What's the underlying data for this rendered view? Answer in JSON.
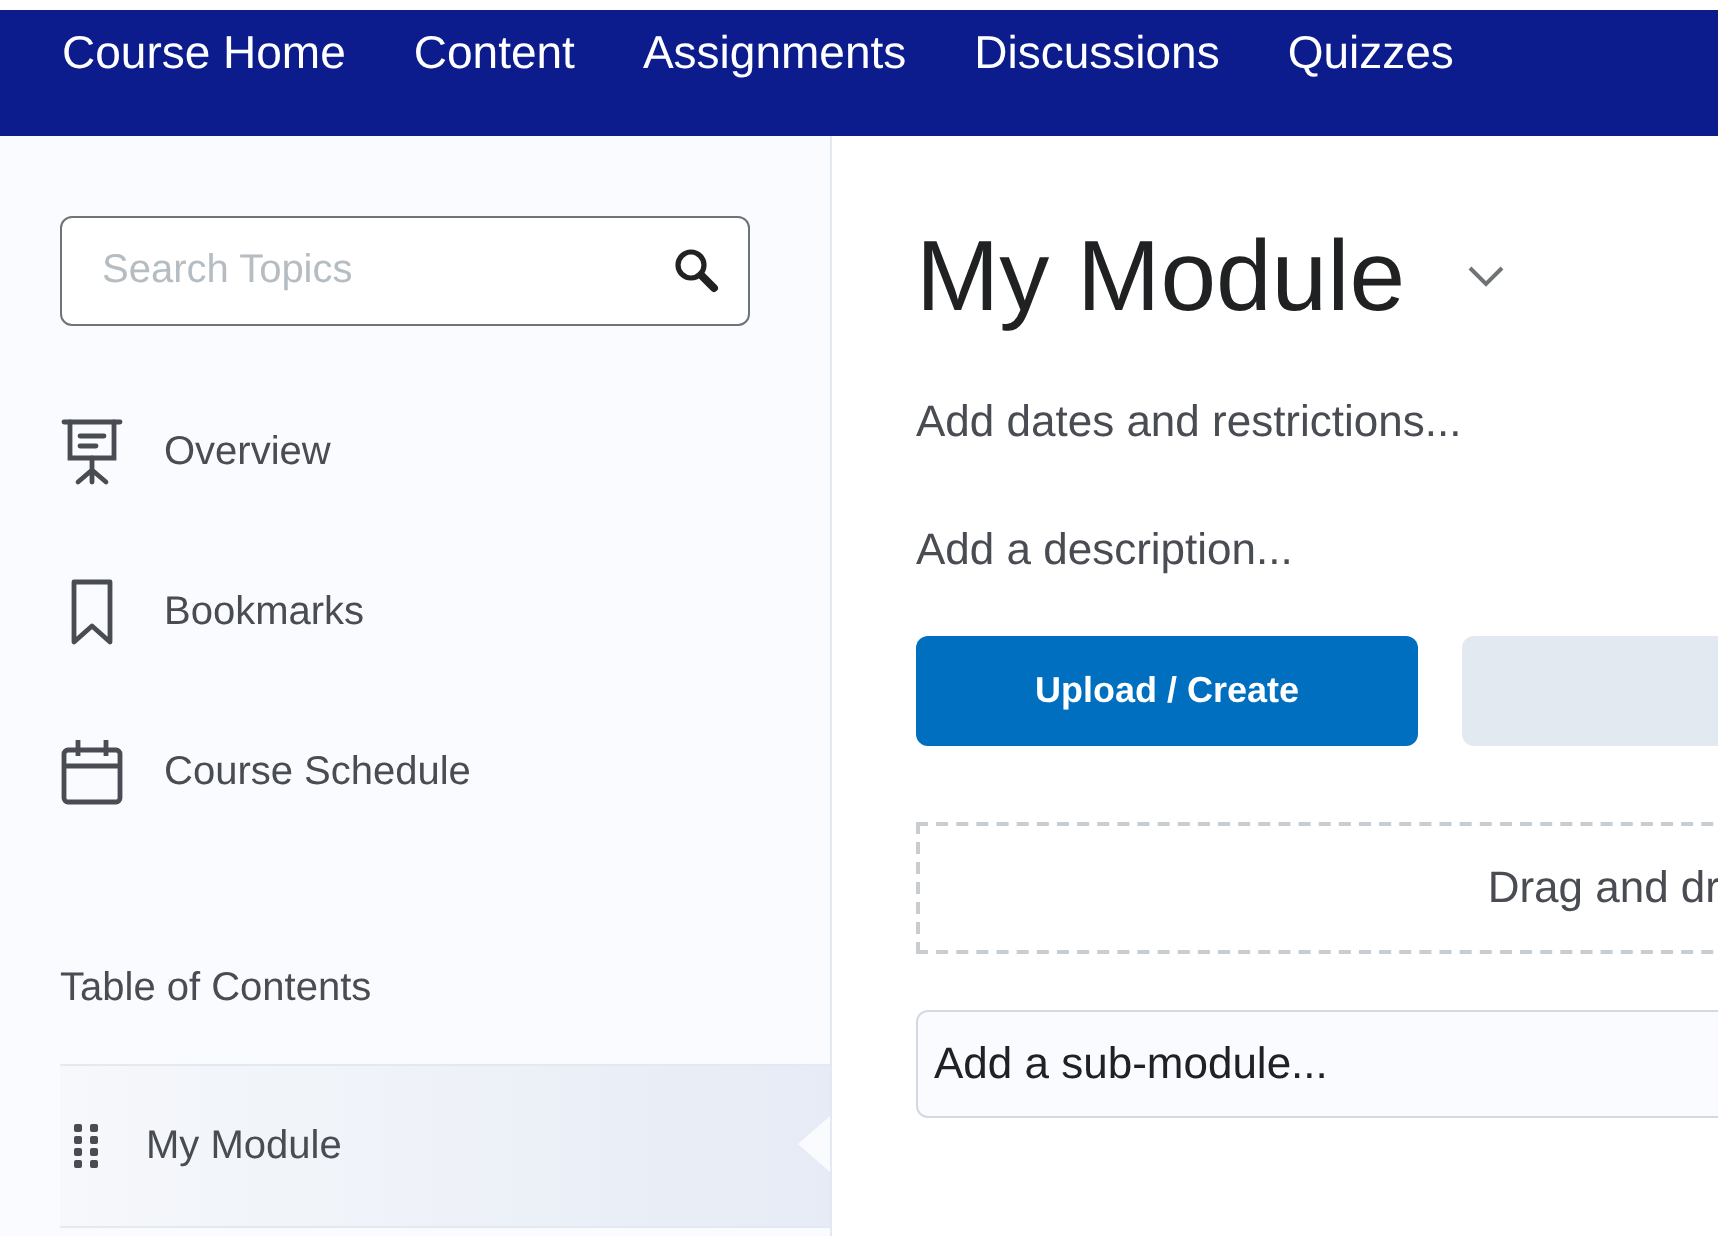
{
  "nav": {
    "items": [
      {
        "label": "Course Home"
      },
      {
        "label": "Content"
      },
      {
        "label": "Assignments"
      },
      {
        "label": "Discussions"
      },
      {
        "label": "Quizzes"
      }
    ]
  },
  "sidebar": {
    "search": {
      "placeholder": "Search Topics"
    },
    "items": [
      {
        "kind": "overview",
        "label": "Overview"
      },
      {
        "kind": "bookmarks",
        "label": "Bookmarks"
      },
      {
        "kind": "schedule",
        "label": "Course Schedule"
      }
    ],
    "toc_heading": "Table of Contents",
    "modules": [
      {
        "label": "My Module",
        "selected": true
      }
    ]
  },
  "main": {
    "title": "My Module",
    "dates_link": "Add dates and restrictions...",
    "description_link": "Add a description...",
    "upload_button": "Upload / Create",
    "drop_zone": "Drag and dr",
    "submodule": {
      "placeholder": "Add a sub-module..."
    }
  }
}
